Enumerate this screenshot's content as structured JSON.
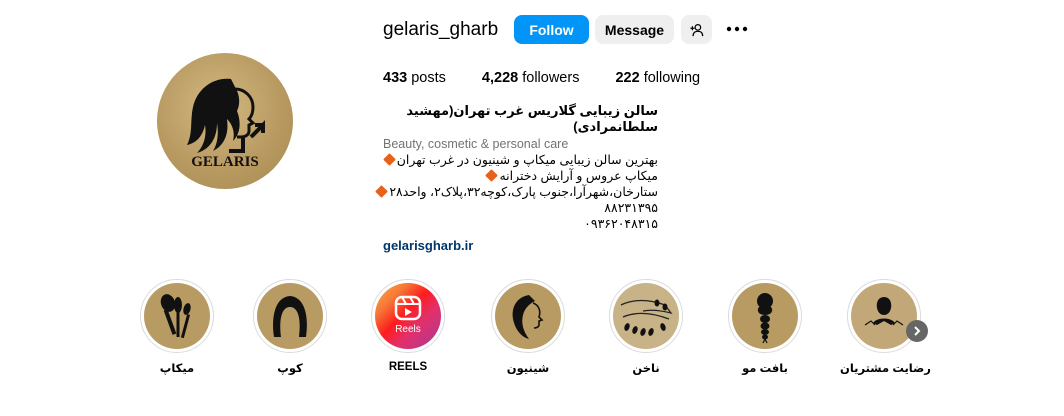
{
  "profile": {
    "username": "gelaris_gharb",
    "logo_text": "GELARIS",
    "follow_label": "Follow",
    "message_label": "Message"
  },
  "stats": {
    "posts_count": "433",
    "posts_label": "posts",
    "followers_count": "4,228",
    "followers_label": "followers",
    "following_count": "222",
    "following_label": "following"
  },
  "bio": {
    "name": "سالن زیبایی گلاریس غرب تهران(مهشید سلطانمرادی)",
    "category": "Beauty, cosmetic & personal care",
    "line1": "بهترین سالن زیبایی میکاپ و شینیون در غرب تهران",
    "line2": "میکاپ عروس و آرایش دخترانه",
    "line3": "ستارخان،شهرآرا،جنوب پارک،کوچه۳۲،پلاک۲، واحد۲۸",
    "line4": "۸۸۲۳۱۳۹۵",
    "line5": "۰۹۳۶۲۰۴۸۳۱۵",
    "link": "gelarisgharb.ir"
  },
  "highlights": [
    {
      "label": "میکاپ",
      "icon": "makeup-brushes-icon"
    },
    {
      "label": "کوپ",
      "icon": "haircut-icon"
    },
    {
      "label": "REELS",
      "icon": "reels-icon",
      "badge": "Reels"
    },
    {
      "label": "شینیون",
      "icon": "updo-hair-icon"
    },
    {
      "label": "ناخن",
      "icon": "nails-icon"
    },
    {
      "label": "بافت مو",
      "icon": "braid-icon"
    },
    {
      "label": "رضایت مشتریان",
      "icon": "customer-icon"
    }
  ],
  "colors": {
    "accent": "#0095f6",
    "gold": "#b89b63",
    "link": "#00376b",
    "diamond": "#e8611a"
  }
}
